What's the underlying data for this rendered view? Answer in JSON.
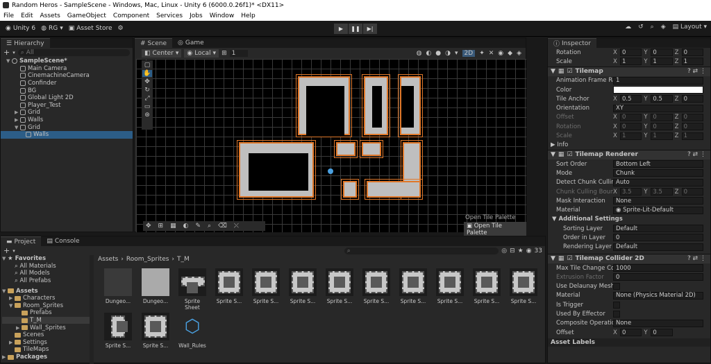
{
  "window": {
    "title": "Random Heros - SampleScene - Windows, Mac, Linux - Unity 6 (6000.0.26f1)* <DX11>"
  },
  "menu": [
    "File",
    "Edit",
    "Assets",
    "GameObject",
    "Component",
    "Services",
    "Jobs",
    "Window",
    "Help"
  ],
  "toolbar": {
    "unity": "Unity 6",
    "account": "RG",
    "asset_store": "Asset Store",
    "layout": "Layout"
  },
  "hierarchy": {
    "tab": "Hierarchy",
    "search_placeholder": "All",
    "scene": "SampleScene*",
    "items": [
      "Main Camera",
      "CinemachineCamera",
      "Confinder",
      "BG",
      "Global Light 2D",
      "Player_Test",
      "Grid",
      "Walls",
      "Grid",
      "Walls"
    ]
  },
  "scene": {
    "tabs": [
      "Scene",
      "Game"
    ],
    "pivot": "Center",
    "space": "Local",
    "snap": "1",
    "mode2d": "2D",
    "tile_palette": "Open Tile Palette"
  },
  "inspector": {
    "tab": "Inspector",
    "transform": [
      {
        "label": "Rotation",
        "x": "0",
        "y": "0",
        "z": "0"
      },
      {
        "label": "Scale",
        "x": "1",
        "y": "1",
        "z": "1"
      }
    ],
    "tilemap": {
      "title": "Tilemap",
      "anim_label": "Animation Frame Rate",
      "anim": "1",
      "color_label": "Color",
      "anchor_label": "Tile Anchor",
      "anchor": {
        "x": "0.5",
        "y": "0.5",
        "z": "0"
      },
      "orient_label": "Orientation",
      "orient": "XY",
      "offset_label": "Offset",
      "offset": {
        "x": "0",
        "y": "0",
        "z": "0"
      },
      "rot_label": "Rotation",
      "rot": {
        "x": "0",
        "y": "0",
        "z": "0"
      },
      "scale_label": "Scale",
      "scale": {
        "x": "1",
        "y": "1",
        "z": "1"
      },
      "info": "Info"
    },
    "renderer": {
      "title": "Tilemap Renderer",
      "sort_label": "Sort Order",
      "sort": "Bottom Left",
      "mode_label": "Mode",
      "mode": "Chunk",
      "detect_label": "Detect Chunk Culling",
      "detect": "Auto",
      "bounds_label": "Chunk Culling Bounds",
      "bounds": {
        "x": "3.5",
        "y": "3.5",
        "z": "0"
      },
      "mask_label": "Mask Interaction",
      "mask": "None",
      "material_label": "Material",
      "material": "Sprite-Lit-Default",
      "additional": "Additional Settings",
      "layer_label": "Sorting Layer",
      "layer": "Default",
      "order_label": "Order in Layer",
      "order": "0",
      "rlayer_label": "Rendering Layer Mask",
      "rlayer": "Default"
    },
    "collider": {
      "title": "Tilemap Collider 2D",
      "max_label": "Max Tile Change Count",
      "max": "1000",
      "extrusion_label": "Extrusion Factor",
      "extrusion": "0",
      "delaunay_label": "Use Delaunay Mesh",
      "material_label": "Material",
      "material": "None (Physics Material 2D)",
      "trigger_label": "Is Trigger",
      "effector_label": "Used By Effector",
      "composite_label": "Composite Operation",
      "composite": "None",
      "offset_label": "Offset",
      "offset": {
        "x": "0",
        "y": "0"
      }
    },
    "asset_labels": "Asset Labels"
  },
  "project": {
    "tabs": [
      "Project",
      "Console"
    ],
    "count": "33",
    "breadcrumb": [
      "Assets",
      "Room_Sprites",
      "T_M"
    ],
    "favorites": {
      "label": "Favorites",
      "items": [
        "All Materials",
        "All Models",
        "All Prefabs"
      ]
    },
    "assets_label": "Assets",
    "tree": [
      "Characters",
      "Room_Sprites",
      "Prefabs",
      "T_M",
      "Wall_Sprites",
      "Scenes",
      "Settings",
      "TileMaps",
      "Packages"
    ],
    "assets": [
      "Dungeo...",
      "Dungeo...",
      "Sprite Sheet",
      "Sprite S...",
      "Sprite S...",
      "Sprite S...",
      "Sprite S...",
      "Sprite S...",
      "Sprite S...",
      "Sprite S...",
      "Sprite S...",
      "Sprite S...",
      "Sprite S...",
      "Wall_Rules"
    ]
  },
  "colors": {
    "accent": "#e0782a",
    "selection": "#2c5d87",
    "panel": "#282828"
  }
}
